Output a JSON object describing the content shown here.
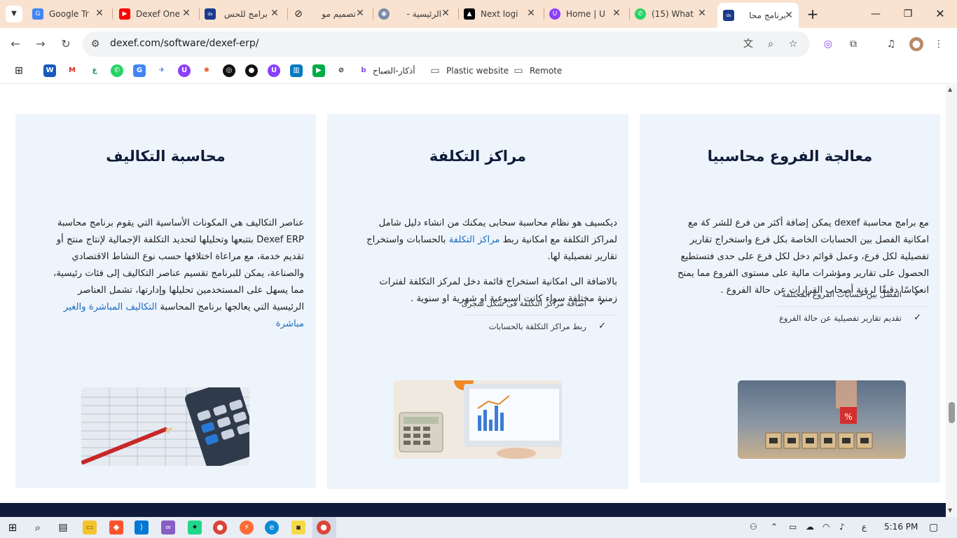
{
  "browser": {
    "tabs": [
      {
        "title": "Google Tr",
        "icon": "google-translate-icon"
      },
      {
        "title": "Dexef One",
        "icon": "youtube-icon"
      },
      {
        "title": "برامج للحس",
        "icon": "dexef-icon"
      },
      {
        "title": "تصميم مو",
        "icon": "ai-icon"
      },
      {
        "title": "الرئيسية -",
        "icon": "site-icon"
      },
      {
        "title": "Next logi",
        "icon": "vercel-icon"
      },
      {
        "title": "Home | U",
        "icon": "unicorn-icon"
      },
      {
        "title": "(15) What",
        "icon": "whatsapp-icon"
      },
      {
        "title": "برنامج محا",
        "icon": "dexef-icon"
      }
    ],
    "url": "dexef.com/software/dexef-erp/",
    "bookmarks": [
      {
        "label": "أذكار-الصباح"
      },
      {
        "label": "Plastic website"
      },
      {
        "label": "Remote"
      }
    ]
  },
  "cards": [
    {
      "title": "معالجة الفروع محاسبيا",
      "lines": [
        "مع برامج محاسبة dexef يمكن  إضافة أكثر من فرع للشر كة مع",
        "امكانية الفصل بين الحسابات الخاصة بكل فرع واستخراج تقارير",
        "تفصيلية لكل فرع، وعمل قوائم دخل لكل فرع على حدى فتستطيع",
        "الحصول على تقارير ومؤشرات مالية على مستوى الفروع مما يمنح",
        "انعكاسًا دقيقًا لرؤية أصحاب القرارات عن حالة الفروع ."
      ],
      "checks": [
        "الفصل بين حسابات الفروع المختلفة",
        "تقديم تقارير تفصيلية عن حالة الفروع"
      ]
    },
    {
      "title": "مراكز التكلفة",
      "p1_a": "ديكسيف هو نظام محاسبة سحابى يمكنك من انشاء دليل شامل",
      "p1_b_pre": "لمراكز التكلفة مع امكانية ربط ",
      "p1_b_link": "مراكز التكلفة",
      "p1_b_post": " بالحسابات واستخراج",
      "p1_c": "تقارير تفصيلية لها.",
      "p2_a": "بالاضافة الى امكانية استخراج قائمة دخل لمركز التكلفة لفترات",
      "p2_b": "زمنية مختلفة سواء كانت اسبوعية او شهرية او سنوية .",
      "checks": [
        "اضافة مراكز التكلفة فى شكل شجرى",
        "ربط مراكز التكلفة بالحسابات"
      ]
    },
    {
      "title": "محاسبة التكاليف",
      "lines": [
        " عناصر التكاليف هي المكونات الأساسية التي يقوم  برنامج محاسبة",
        "Dexef ERP بتتبعها وتحليلها لتحديد التكلفة الإجمالية لإنتاج منتج أو",
        "تقديم خدمة، مع مراعاة اختلافها حسب نوع النشاط الاقتصادي",
        "والصناعة، يمكن للبرنامج تقسيم عناصر التكاليف إلى فئات رئيسية،",
        "مما يسهل على المستخدمين تحليلها وإدارتها، تشمل  العناصر"
      ],
      "last_pre": "الرئيسية التي يعالجها برنامج المحاسبة  ",
      "last_link": "التكاليف المباشرة والغير",
      "last_link2": "مباشرة"
    }
  ],
  "taskbar": {
    "time": "5:16 PM",
    "lang": "ع"
  }
}
